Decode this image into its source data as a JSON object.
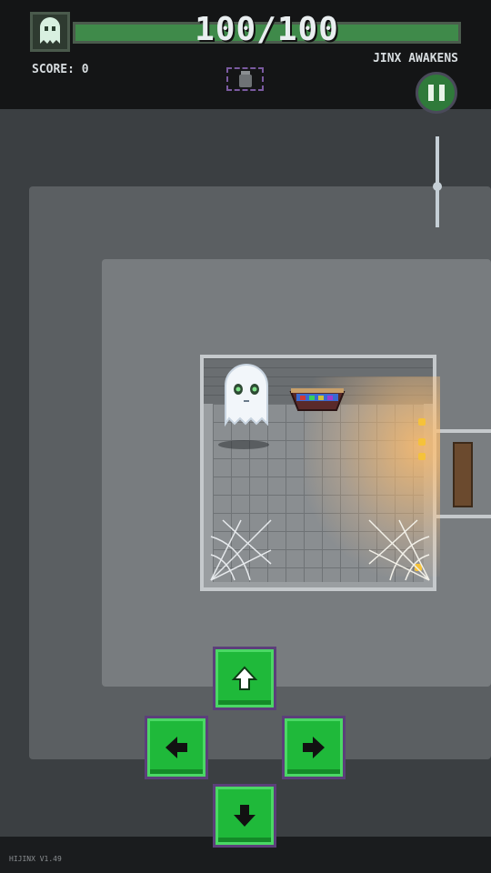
{
  "hud": {
    "health_text": "100/100",
    "health_current": 100,
    "health_max": 100,
    "score_text": "SCORE: 0",
    "level_name": "JINX AWAKENS"
  },
  "controls": {
    "zoom_level": 0.55,
    "dpad": [
      "up",
      "left",
      "right",
      "down"
    ]
  },
  "footer": {
    "version": "HIJINX V1.49"
  },
  "icons": {
    "avatar": "ghost-icon",
    "item_slot": "jar-icon",
    "pause": "pause-icon",
    "up": "arrow-up-icon",
    "left": "arrow-left-icon",
    "right": "arrow-right-icon",
    "down": "arrow-down-icon"
  },
  "colors": {
    "accent_green": "#1fb93a",
    "health_green": "#3f8a4a",
    "button_border": "#5c3f7a"
  }
}
